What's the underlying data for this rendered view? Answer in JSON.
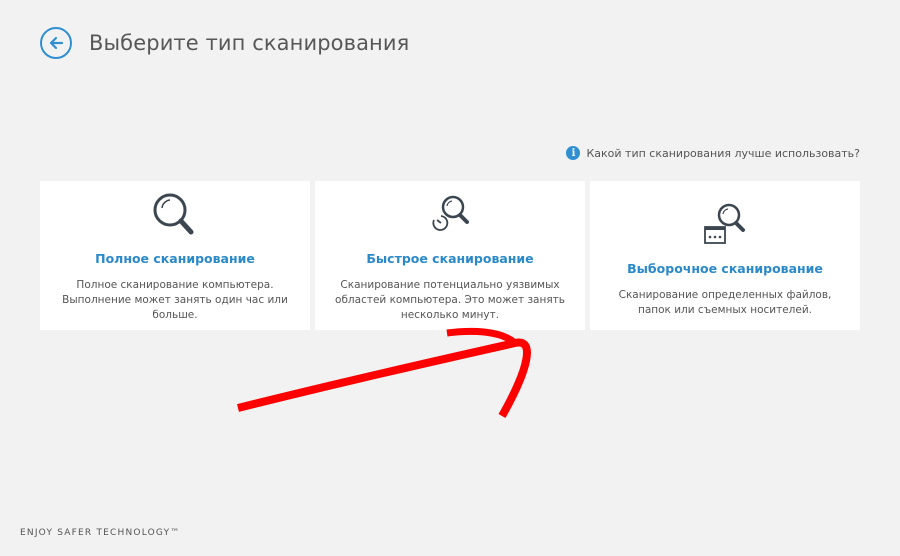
{
  "header": {
    "back_icon": "arrow-left-icon",
    "title": "Выберите тип сканирования"
  },
  "help": {
    "icon": "info-icon",
    "text": "Какой тип сканирования лучше использовать?"
  },
  "cards": [
    {
      "icon": "magnifier-icon",
      "title": "Полное сканирование",
      "description": "Полное сканирование компьютера. Выполнение может занять один час или больше."
    },
    {
      "icon": "magnifier-clock-icon",
      "title": "Быстрое сканирование",
      "description": "Сканирование потенциально уязвимых областей компьютера. Это может занять несколько минут."
    },
    {
      "icon": "magnifier-drive-icon",
      "title": "Выборочное сканирование",
      "description": "Сканирование определенных файлов, папок или съемных носителей."
    }
  ],
  "footer": {
    "text": "ENJOY SAFER TECHNOLOGY™"
  },
  "colors": {
    "accent": "#2f8fd1",
    "annotation_arrow": "#ff0000"
  }
}
